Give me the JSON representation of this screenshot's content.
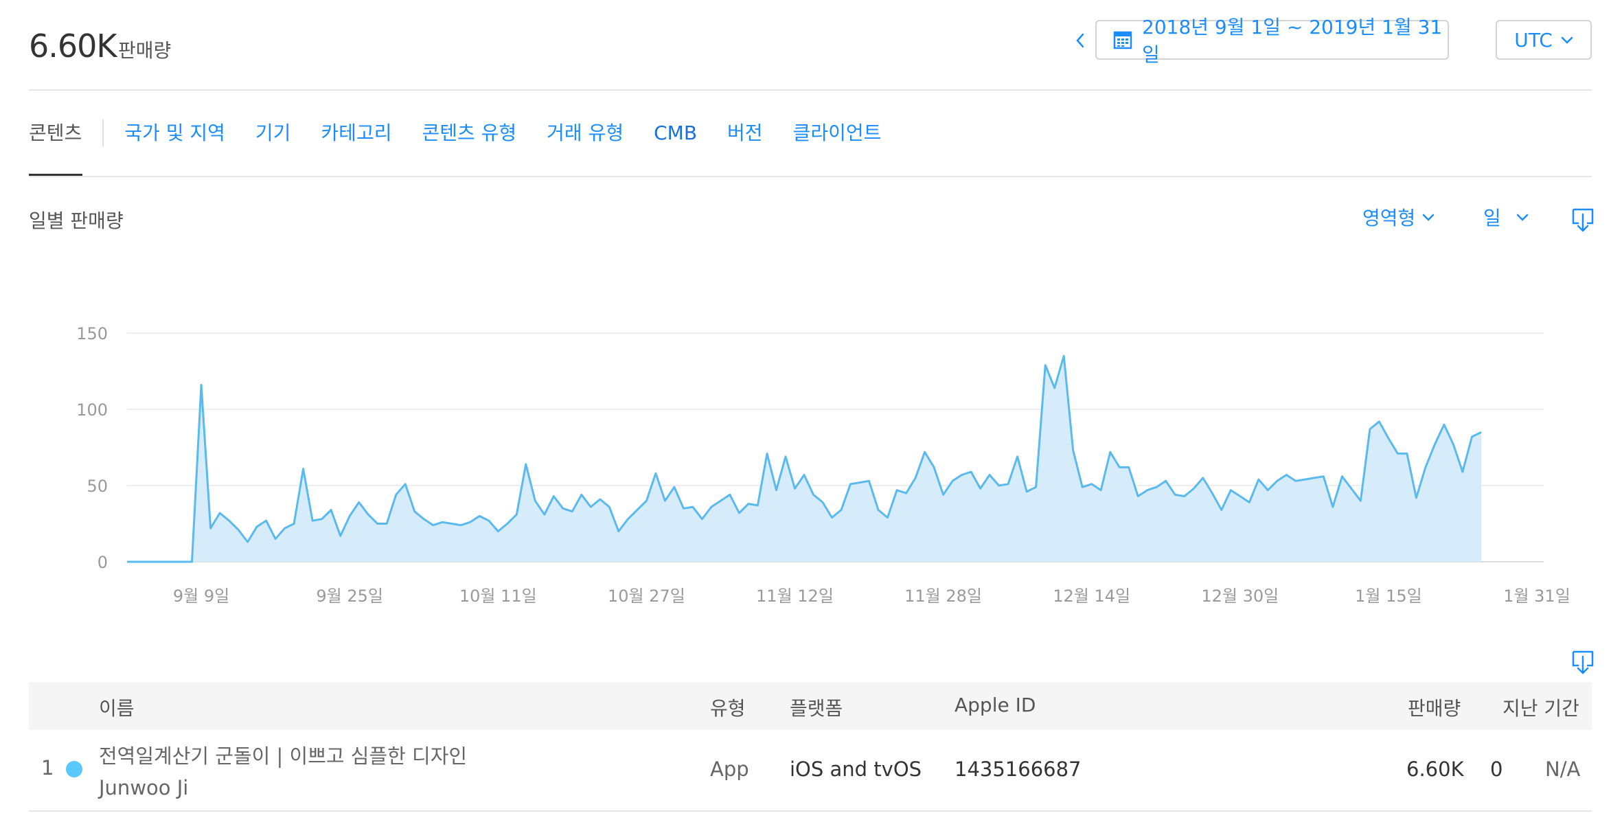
{
  "header": {
    "total_value": "6.60K",
    "total_label": "판매량",
    "date_range": "2018년 9월 1일 ~ 2019년 1월 31일",
    "timezone": "UTC"
  },
  "tabs": [
    {
      "label": "콘텐츠",
      "active": true
    },
    {
      "label": "국가 및 지역"
    },
    {
      "label": "기기"
    },
    {
      "label": "카테고리"
    },
    {
      "label": "콘텐츠 유형"
    },
    {
      "label": "거래 유형"
    },
    {
      "label": "CMB"
    },
    {
      "label": "버전"
    },
    {
      "label": "클라이언트"
    }
  ],
  "chart_section": {
    "title": "일별 판매량",
    "type_select": "영역형",
    "granularity_select": "일"
  },
  "chart_data": {
    "type": "area",
    "title": "",
    "xlabel": "",
    "ylabel": "",
    "ylim": [
      0,
      150
    ],
    "yticks": [
      0,
      50,
      100,
      150
    ],
    "x_start": "9월 1일",
    "x_tick_labels": [
      "9월 9일",
      "9월 25일",
      "10월 11일",
      "10월 27일",
      "11월 12일",
      "11월 28일",
      "12월 14일",
      "12월 30일",
      "1월 15일",
      "1월 31일"
    ],
    "x_tick_days": [
      8,
      24,
      40,
      56,
      72,
      88,
      104,
      120,
      136,
      152
    ],
    "color": "#5ab9ee",
    "fill": "#d6ecfa",
    "values": [
      0,
      0,
      0,
      0,
      0,
      0,
      0,
      0,
      116,
      22,
      32,
      27,
      21,
      13,
      23,
      27,
      15,
      22,
      25,
      61,
      27,
      28,
      34,
      17,
      30,
      39,
      31,
      25,
      25,
      44,
      51,
      33,
      28,
      24,
      26,
      25,
      24,
      26,
      30,
      27,
      20,
      25,
      31,
      64,
      40,
      31,
      43,
      35,
      33,
      44,
      36,
      41,
      36,
      20,
      28,
      34,
      40,
      58,
      40,
      49,
      35,
      36,
      28,
      36,
      40,
      44,
      32,
      38,
      37,
      71,
      47,
      69,
      48,
      57,
      44,
      39,
      29,
      34,
      51,
      52,
      53,
      34,
      29,
      47,
      45,
      55,
      72,
      62,
      44,
      53,
      57,
      59,
      48,
      57,
      50,
      51,
      69,
      46,
      49,
      129,
      114,
      135,
      73,
      49,
      51,
      47,
      72,
      62,
      62,
      43,
      47,
      49,
      53,
      44,
      43,
      48,
      55,
      45,
      34,
      47,
      43,
      39,
      54,
      47,
      53,
      57,
      53,
      54,
      55,
      56,
      36,
      56,
      48,
      40,
      87,
      92,
      81,
      71,
      71,
      42,
      62,
      77,
      90,
      77,
      59,
      82,
      85
    ]
  },
  "table": {
    "headers": {
      "name": "이름",
      "type": "유형",
      "platform": "플랫폼",
      "apple_id": "Apple ID",
      "sales": "판매량",
      "previous": "지난 기간"
    },
    "rows": [
      {
        "rank": "1",
        "dot_color": "#5ac8fa",
        "name": "전역일계산기 군돌이 | 이쁘고 심플한 디자인",
        "developer": "Junwoo Ji",
        "type": "App",
        "platform": "iOS and tvOS",
        "apple_id": "1435166687",
        "sales": "6.60K",
        "previous_value": "0",
        "previous_change": "N/A"
      }
    ]
  }
}
